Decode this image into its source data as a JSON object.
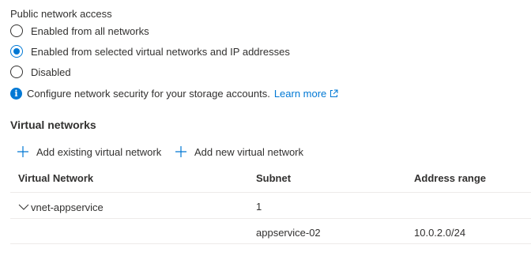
{
  "public_network_access": {
    "label": "Public network access",
    "options": [
      {
        "label": "Enabled from all networks",
        "selected": false
      },
      {
        "label": "Enabled from selected virtual networks and IP addresses",
        "selected": true
      },
      {
        "label": "Disabled",
        "selected": false
      }
    ]
  },
  "info": {
    "icon": "info-icon",
    "text": "Configure network security for your storage accounts.",
    "link_label": "Learn more"
  },
  "virtual_networks": {
    "title": "Virtual networks",
    "toolbar": {
      "add_existing_label": "Add existing virtual network",
      "add_new_label": "Add new virtual network"
    },
    "columns": [
      "Virtual Network",
      "Subnet",
      "Address range"
    ],
    "rows": [
      {
        "network": "vnet-appservice",
        "subnet": "1",
        "address_range": ""
      },
      {
        "network": "",
        "subnet": "appservice-02",
        "address_range": "10.0.2.0/24"
      }
    ]
  },
  "colors": {
    "accent": "#0078d4",
    "text": "#323130",
    "divider": "#edebe9"
  }
}
